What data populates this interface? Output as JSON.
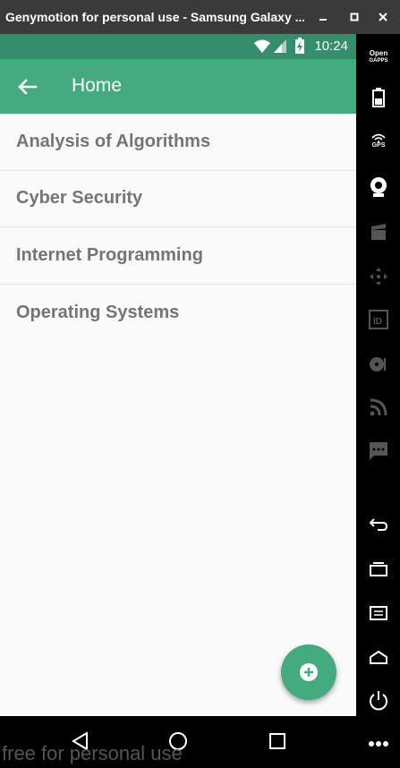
{
  "window": {
    "title": "Genymotion for personal use - Samsung Galaxy ...",
    "minimize_icon": "minimize-icon",
    "maximize_icon": "maximize-icon",
    "close_icon": "close-icon"
  },
  "status_bar": {
    "time": "10:24",
    "icons": [
      "wifi-icon",
      "signal-icon",
      "battery-charging-icon"
    ]
  },
  "app_bar": {
    "title": "Home",
    "back_icon": "arrow-back-icon"
  },
  "list": {
    "items": [
      {
        "label": "Analysis of Algorithms"
      },
      {
        "label": "Cyber Security"
      },
      {
        "label": "Internet Programming"
      },
      {
        "label": "Operating Systems"
      }
    ]
  },
  "fab": {
    "icon": "add-circle-icon"
  },
  "nav_bar": {
    "icons": [
      "back-triangle-icon",
      "home-circle-icon",
      "recents-square-icon"
    ]
  },
  "watermark": "free for personal use",
  "side_toolbar": {
    "opengapps_line1": "Open",
    "opengapps_line2": "GAPPS",
    "gps_label": "GPS",
    "items": [
      "battery-icon",
      "gps-icon",
      "webcam-icon",
      "capture-icon",
      "dpad-icon",
      "id-icon",
      "disk-icon",
      "rss-icon",
      "sms-icon",
      "back-icon",
      "recent-apps-icon",
      "menu-icon",
      "home-icon",
      "power-icon",
      "more-icon"
    ]
  },
  "colors": {
    "accent": "#44aa7f",
    "status_bar": "#368d6b",
    "list_text": "#757575",
    "title_bar": "#3a3a3a"
  }
}
